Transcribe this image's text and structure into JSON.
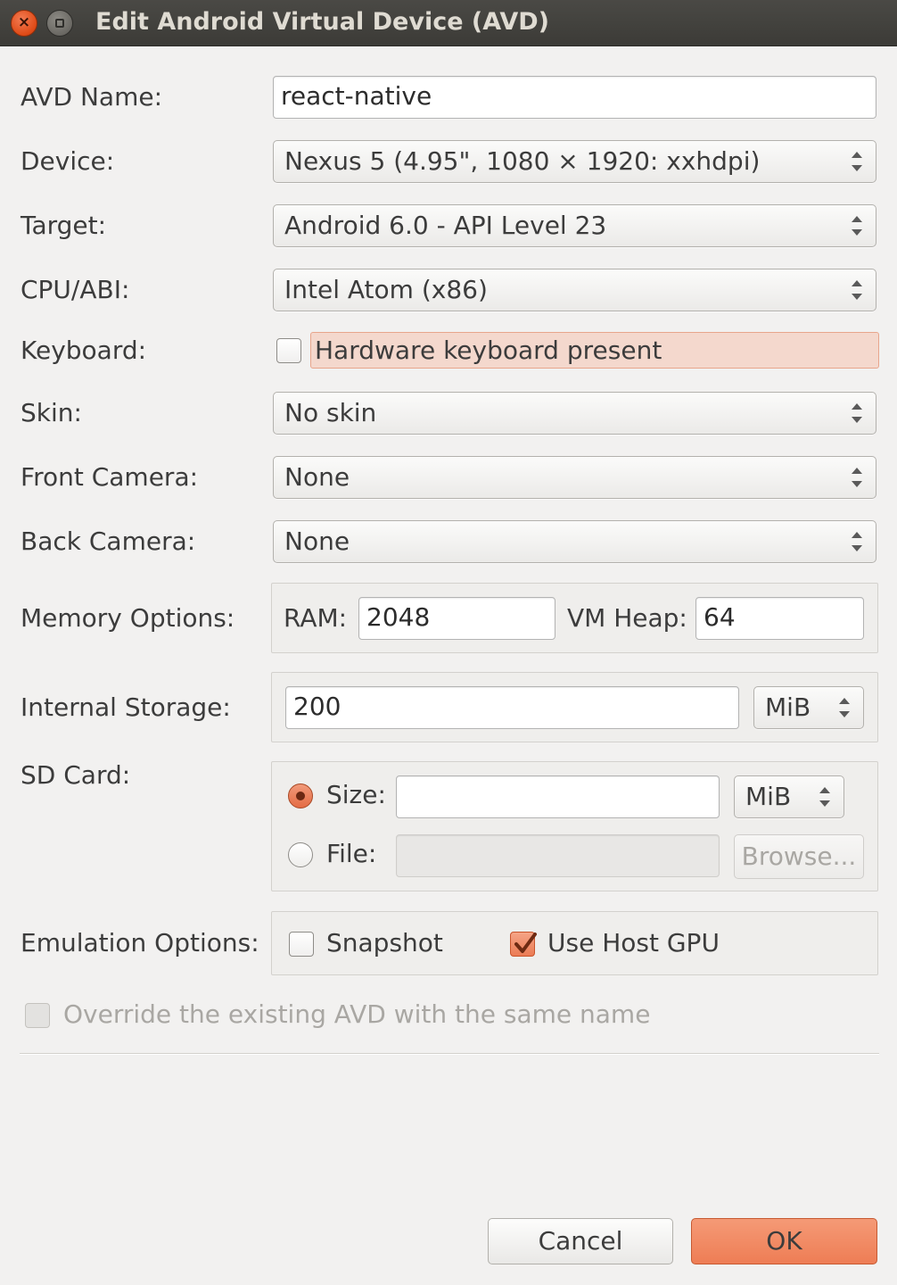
{
  "window": {
    "title": "Edit Android Virtual Device (AVD)",
    "close_glyph": "×"
  },
  "avd_name": {
    "label": "AVD Name:",
    "value": "react-native"
  },
  "device": {
    "label": "Device:",
    "value": "Nexus 5 (4.95\", 1080 × 1920: xxhdpi)"
  },
  "target": {
    "label": "Target:",
    "value": "Android 6.0 - API Level 23"
  },
  "cpu_abi": {
    "label": "CPU/ABI:",
    "value": "Intel Atom (x86)"
  },
  "keyboard": {
    "label": "Keyboard:",
    "checkbox_label": "Hardware keyboard present",
    "checked": false
  },
  "skin": {
    "label": "Skin:",
    "value": "No skin"
  },
  "front_camera": {
    "label": "Front Camera:",
    "value": "None"
  },
  "back_camera": {
    "label": "Back Camera:",
    "value": "None"
  },
  "memory": {
    "label": "Memory Options:",
    "ram_label": "RAM:",
    "ram_value": "2048",
    "vm_heap_label": "VM Heap:",
    "vm_heap_value": "64"
  },
  "internal_storage": {
    "label": "Internal Storage:",
    "value": "200",
    "unit": "MiB"
  },
  "sd_card": {
    "label": "SD Card:",
    "size_label": "Size:",
    "size_value": "",
    "size_unit": "MiB",
    "file_label": "File:",
    "file_value": "",
    "browse_label": "Browse...",
    "selected": "size"
  },
  "emulation": {
    "label": "Emulation Options:",
    "snapshot_label": "Snapshot",
    "snapshot_checked": false,
    "host_gpu_label": "Use Host GPU",
    "host_gpu_checked": true
  },
  "override": {
    "label": "Override the existing AVD with the same name",
    "checked": false,
    "enabled": false
  },
  "buttons": {
    "cancel": "Cancel",
    "ok": "OK"
  },
  "colors": {
    "accent": "#ee7d55",
    "title_bar": "#3c3b37",
    "background": "#f2f1f0"
  },
  "icons": {
    "close": "close-icon",
    "minimize": "minimize-icon",
    "spin": "spin-arrows-icon",
    "check": "checkmark-icon"
  }
}
